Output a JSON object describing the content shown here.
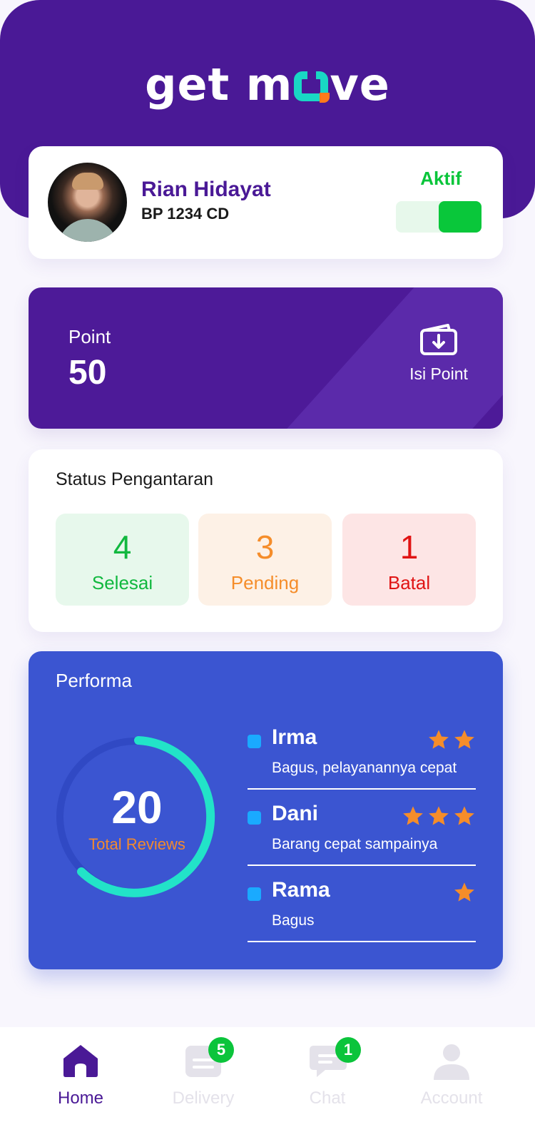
{
  "app": {
    "logo_text_left": "get m",
    "logo_text_right": "ve"
  },
  "profile": {
    "name": "Rian Hidayat",
    "plate": "BP 1234 CD",
    "status_label": "Aktif",
    "status_on": true
  },
  "points": {
    "label": "Point",
    "value": "50",
    "topup_label": "Isi Point",
    "topup_icon": "wallet-download-icon"
  },
  "delivery_status": {
    "title": "Status Pengantaran",
    "items": [
      {
        "count": "4",
        "label": "Selesai",
        "color": "#11b83f"
      },
      {
        "count": "3",
        "label": "Pending",
        "color": "#f58d2a"
      },
      {
        "count": "1",
        "label": "Batal",
        "color": "#e01414"
      }
    ]
  },
  "performance": {
    "title": "Performa",
    "total_reviews": "20",
    "total_reviews_label": "Total Reviews",
    "reviews": [
      {
        "name": "Irma",
        "comment": "Bagus, pelayanannya cepat",
        "stars": 2
      },
      {
        "name": "Dani",
        "comment": "Barang cepat sampainya",
        "stars": 3
      },
      {
        "name": "Rama",
        "comment": "Bagus",
        "stars": 1
      }
    ]
  },
  "tabbar": {
    "items": [
      {
        "label": "Home",
        "icon": "home-icon",
        "active": true
      },
      {
        "label": "Delivery",
        "icon": "delivery-icon",
        "active": false,
        "badge": "5"
      },
      {
        "label": "Chat",
        "icon": "chat-icon",
        "active": false,
        "badge": "1"
      },
      {
        "label": "Account",
        "icon": "account-icon",
        "active": false
      }
    ]
  },
  "colors": {
    "primary": "#4a1996",
    "accent": "#19d7c4",
    "performance_bg": "#3b55d1",
    "active_green": "#09c53a",
    "star": "#f58d2a"
  }
}
